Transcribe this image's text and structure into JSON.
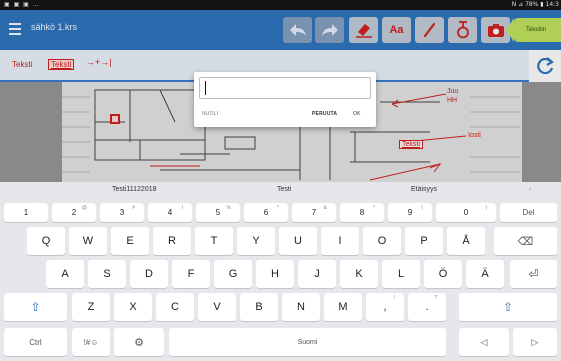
{
  "status_bar": {
    "left_icons": "▣ ▣ ▣ …",
    "right": "N ⊿ 78% ▮ 14:3"
  },
  "app_bar": {
    "menu_icon": "hamburger-icon",
    "title": "sähkö 1.krs",
    "tools": [
      "undo-icon",
      "redo-icon",
      "eraser-icon",
      "text-icon",
      "pen-icon",
      "stamp-icon",
      "camera-icon"
    ],
    "text_tool_label": "Aa",
    "next_button_label": "Tekstiin"
  },
  "sub_toolbar": {
    "tool_1": "Teksti",
    "tool_2": "Teksti",
    "tool_3": "→+→|",
    "refresh_icon": "refresh-icon"
  },
  "canvas": {
    "labels": {
      "juu": "Juu",
      "hh": "HH",
      "iosti": "Iosti",
      "teksti": "Teksti"
    }
  },
  "dialog": {
    "input_value": "",
    "input_placeholder": "",
    "arrow_button": "NUOLI",
    "cancel_button": "PERUUTA",
    "ok_button": "OK"
  },
  "keyboard": {
    "suggestions": [
      "Testi11122018",
      "Testi",
      "Etäisyys",
      "›"
    ],
    "row_numbers": [
      {
        "label": "1",
        "hint": "`"
      },
      {
        "label": "2",
        "hint": "@"
      },
      {
        "label": "3",
        "hint": "#"
      },
      {
        "label": "4",
        "hint": "/"
      },
      {
        "label": "5",
        "hint": "%"
      },
      {
        "label": "6",
        "hint": "^"
      },
      {
        "label": "7",
        "hint": "&"
      },
      {
        "label": "8",
        "hint": "*"
      },
      {
        "label": "9",
        "hint": "("
      },
      {
        "label": "0",
        "hint": ")"
      }
    ],
    "del_label": "Del",
    "row_q": [
      "Q",
      "W",
      "E",
      "R",
      "T",
      "Y",
      "U",
      "I",
      "O",
      "P",
      "Å"
    ],
    "backspace_icon": "⌫",
    "row_a": [
      "A",
      "S",
      "D",
      "F",
      "G",
      "H",
      "J",
      "K",
      "L",
      "Ö",
      "Ä"
    ],
    "enter_icon": "⏎",
    "row_z": [
      "Z",
      "X",
      "C",
      "V",
      "B",
      "N",
      "M",
      ",",
      ".",
      "!",
      "?"
    ],
    "shift_icon": "⇧",
    "ctrl_label": "Ctrl",
    "symbols_label": "!#☺",
    "settings_icon": "⚙",
    "space_label": "Suomi",
    "left_arrow": "◁",
    "right_arrow": "▷"
  },
  "colors": {
    "app_bar": "#2d6fb5",
    "accent_red": "#c8201d",
    "next_green": "#b8d85a"
  }
}
